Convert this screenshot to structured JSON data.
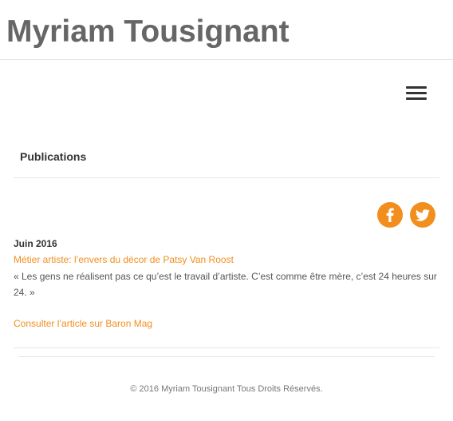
{
  "header": {
    "site_title": "Myriam Tousignant"
  },
  "nav": {
    "menu_icon": "hamburger-menu-icon"
  },
  "main": {
    "heading": "Publications",
    "social": {
      "facebook_icon": "facebook-icon",
      "twitter_icon": "twitter-icon",
      "accent_color": "#f28e1e"
    },
    "entry": {
      "date": "Juin 2016",
      "title": "Métier artiste: l’envers du décor de Patsy Van Roost",
      "quote": "« Les gens ne réalisent pas ce qu’est le travail d’artiste. C’est comme être mère, c’est 24 heures sur 24. »",
      "link": "Consulter l’article sur Baron Mag"
    }
  },
  "footer": {
    "copyright": "© 2016 Myriam Tousignant Tous Droits Réservés."
  }
}
